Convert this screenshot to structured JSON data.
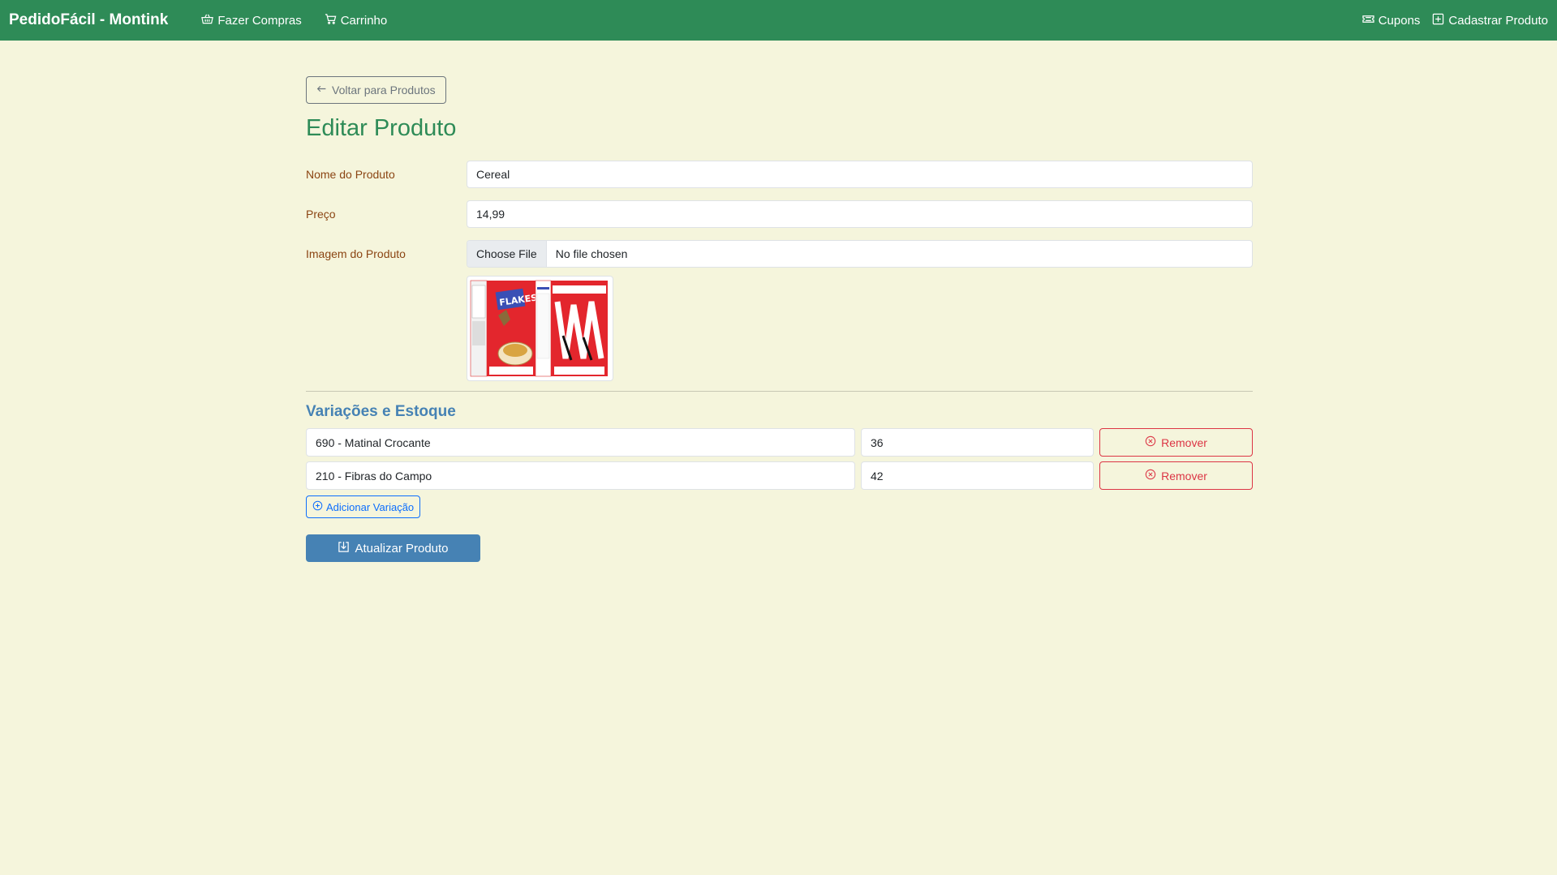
{
  "navbar": {
    "brand": "PedidoFácil - Montink",
    "links_left": [
      {
        "label": "Fazer Compras",
        "icon": "basket-icon"
      },
      {
        "label": "Carrinho",
        "icon": "cart-icon"
      }
    ],
    "links_right": [
      {
        "label": "Cupons",
        "icon": "ticket-icon"
      },
      {
        "label": "Cadastrar Produto",
        "icon": "plus-square-icon"
      }
    ],
    "bg_color": "#2e8b57"
  },
  "page": {
    "back_label": "Voltar para Produtos",
    "title": "Editar Produto"
  },
  "form": {
    "name_label": "Nome do Produto",
    "name_value": "Cereal",
    "price_label": "Preço",
    "price_value": "14,99",
    "image_label": "Imagem do Produto",
    "file_button": "Choose File",
    "file_status": "No file chosen"
  },
  "variations": {
    "title": "Variações e Estoque",
    "items": [
      {
        "name": "690 - Matinal Crocante",
        "qty": "36",
        "remove_label": "Remover"
      },
      {
        "name": "210 - Fibras do Campo",
        "qty": "42",
        "remove_label": "Remover"
      }
    ],
    "add_label": "Adicionar Variação"
  },
  "submit_label": "Atualizar Produto",
  "colors": {
    "background": "#f5f5dc",
    "title": "#2e8b57",
    "label": "#8b4513",
    "section": "#4682b4",
    "danger": "#dc3545",
    "primary": "#0d6efd"
  }
}
